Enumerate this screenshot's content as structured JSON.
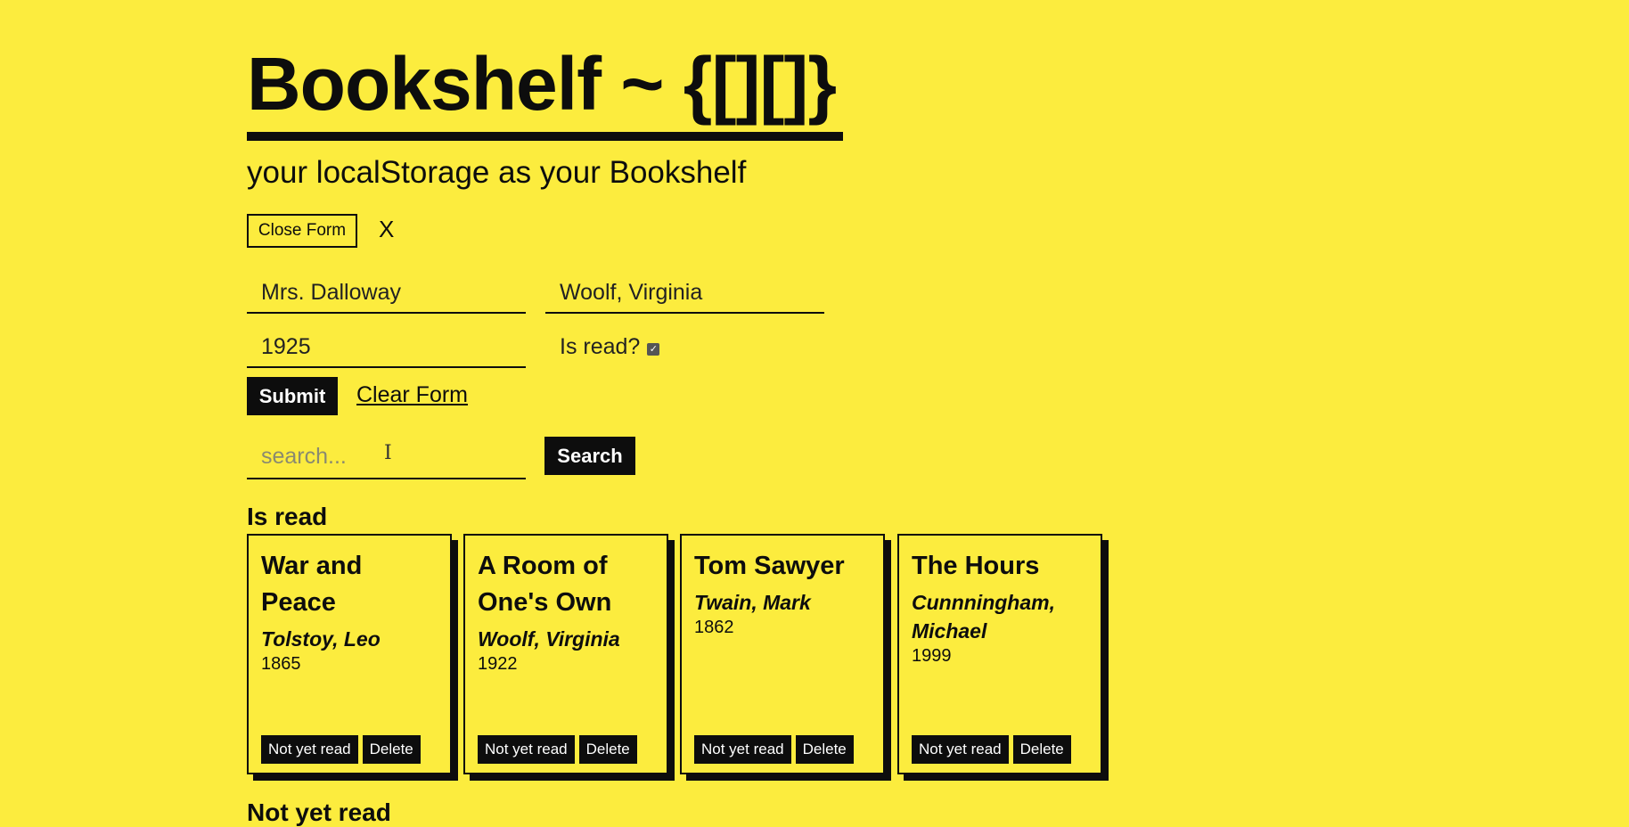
{
  "header": {
    "title": "Bookshelf ~ {[][]}",
    "subtitle": "your localStorage as your Bookshelf"
  },
  "form": {
    "toggle_label": "Close Form",
    "close_label": "X",
    "title_value": "Mrs. Dalloway",
    "author_value": "Woolf, Virginia",
    "year_value": "1925",
    "is_read_label": "Is read?",
    "is_read_checked": true,
    "submit_label": "Submit",
    "clear_label": "Clear Form"
  },
  "search": {
    "placeholder": "search...",
    "button_label": "Search"
  },
  "sections": {
    "read_heading": "Is read",
    "not_read_heading": "Not yet read"
  },
  "books_read": [
    {
      "title": "War and Peace",
      "author": "Tolstoy, Leo",
      "year": "1865",
      "toggle_label": "Not yet read",
      "delete_label": "Delete"
    },
    {
      "title": "A Room of One's Own",
      "author": "Woolf, Virginia",
      "year": "1922",
      "toggle_label": "Not yet read",
      "delete_label": "Delete"
    },
    {
      "title": "Tom Sawyer",
      "author": "Twain, Mark",
      "year": "1862",
      "toggle_label": "Not yet read",
      "delete_label": "Delete"
    },
    {
      "title": "The Hours",
      "author": "Cunnningham, Michael",
      "year": "1999",
      "toggle_label": "Not yet read",
      "delete_label": "Delete"
    }
  ],
  "colors": {
    "background": "#fcec3e",
    "ink": "#0d0d0d"
  }
}
